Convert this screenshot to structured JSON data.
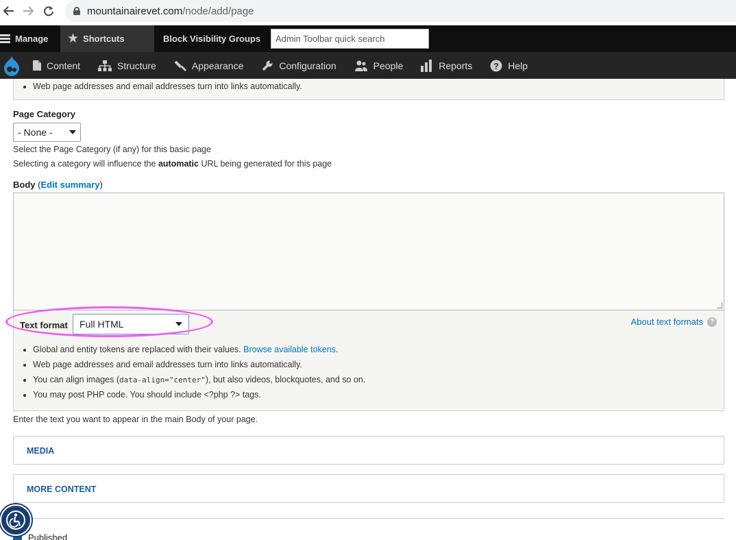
{
  "browser": {
    "url_host": "mountainairevet.com",
    "url_path": "/node/add/page"
  },
  "toolbar": {
    "manage": "Manage",
    "shortcuts": "Shortcuts",
    "block_visibility_groups": "Block Visibility Groups",
    "search_placeholder": "Admin Toolbar quick search"
  },
  "tray": {
    "items": [
      {
        "label": "Content",
        "icon": "file-icon"
      },
      {
        "label": "Structure",
        "icon": "sitemap-icon"
      },
      {
        "label": "Appearance",
        "icon": "paintbrush-icon"
      },
      {
        "label": "Configuration",
        "icon": "wrench-icon"
      },
      {
        "label": "People",
        "icon": "people-icon"
      },
      {
        "label": "Reports",
        "icon": "bar-chart-icon"
      },
      {
        "label": "Help",
        "icon": "question-icon"
      }
    ]
  },
  "prev_tip": "Web page addresses and email addresses turn into links automatically.",
  "page_category": {
    "label": "Page Category",
    "selected": "- None -",
    "desc1": "Select the Page Category (if any) for this basic page",
    "desc2_pre": "Selecting a category will influence the ",
    "desc2_bold": "automatic",
    "desc2_post": " URL being generated for this page"
  },
  "body": {
    "label": "Body",
    "paren_open": " (",
    "edit_summary": "Edit summary",
    "paren_close": ")",
    "help": "Enter the text you want to appear in the main Body of your page."
  },
  "text_format": {
    "label": "Text format",
    "selected": "Full HTML",
    "about": "About text formats",
    "tips": {
      "t1": "Global and entity tokens are replaced with their values. ",
      "t1_link": "Browse available tokens.",
      "t2": "Web page addresses and email addresses turn into links automatically.",
      "t3_pre": "You can align images (",
      "t3_code": "data-align=\"center\"",
      "t3_post": "), but also videos, blockquotes, and so on.",
      "t4": "You may post PHP code. You should include <?php ?> tags."
    }
  },
  "sections": {
    "media": "MEDIA",
    "more_content": "MORE CONTENT"
  },
  "published": "Published",
  "colors": {
    "toolbar": "#0f0f0f",
    "tray": "#252525",
    "link": "#0074bd",
    "highlight": "#f05cf0"
  }
}
